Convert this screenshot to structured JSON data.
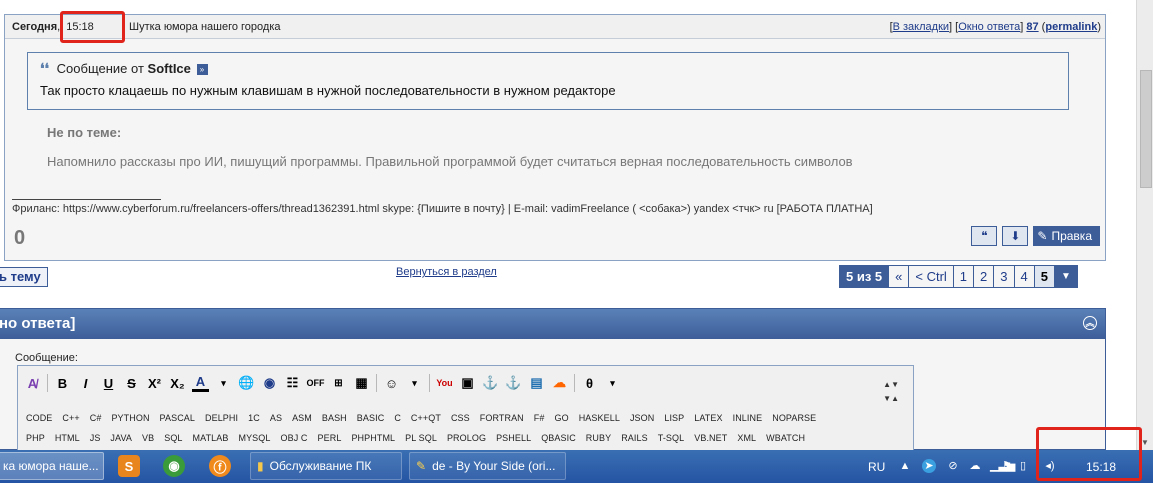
{
  "post": {
    "day": "Сегодня",
    "time": "15:18",
    "title": "Шутка юмора нашего городка",
    "links": {
      "bookmarks": "В закладки",
      "reply_window": "Окно ответа",
      "number": "87",
      "permalink": "permalink"
    },
    "quote": {
      "prefix": "Сообщение от",
      "author": "SoftIce",
      "text": "Так просто клацаешь по нужным клавишам в нужной последовательности в нужном редакторе"
    },
    "offtopic_head": "Не по теме:",
    "offtopic_text": "Напомнило рассказы про ИИ, пишущий программы. Правильной программой будет считаться верная последовательность символов",
    "signature": "Фриланс: https://www.cyberforum.ru/freelancers-offers/thread1362391.html skype: {Пишите в почту} | E-mail: vadimFreelance ( <собака>) yandex <тчк> ru [РАБОТА ПЛАТНА]",
    "rating": "0",
    "edit_label": "Правка"
  },
  "nav": {
    "reply_topic": "ь тему",
    "back_link": "Вернуться в раздел",
    "pager": {
      "summary": "5 из 5",
      "first": "«",
      "prev": "< Ctrl",
      "pages": [
        "1",
        "2",
        "3",
        "4",
        "5"
      ],
      "current": "5"
    }
  },
  "reply": {
    "bar_title": "но ответа]",
    "message_label": "Сообщение:",
    "toolbar_off": "OFF",
    "langs_row1": [
      "CODE",
      "C++",
      "C#",
      "PYTHON",
      "PASCAL",
      "DELPHI",
      "1C",
      "AS",
      "ASM",
      "BASH",
      "BASIC",
      "C",
      "C++QT",
      "CSS",
      "FORTRAN",
      "F#",
      "GO",
      "HASKELL",
      "JSON",
      "LISP",
      "LATEX",
      "INLINE",
      "NOPARSE"
    ],
    "langs_row2": [
      "PHP",
      "HTML",
      "JS",
      "JAVA",
      "VB",
      "SQL",
      "MATLAB",
      "MYSQL",
      "OBJ C",
      "PERL",
      "PHPHTML",
      "PL SQL",
      "PROLOG",
      "PSHELL",
      "QBASIC",
      "RUBY",
      "RAILS",
      "T-SQL",
      "VB.NET",
      "XML",
      "WBATCH"
    ]
  },
  "taskbar": {
    "tasks": [
      "ка юмора наше...",
      "Обслуживание ПК",
      "de - By Your Side (ori..."
    ],
    "lang": "RU",
    "clock": "15:18"
  },
  "colors": {
    "accent": "#3d5d99",
    "highlight": "#e0231b",
    "taskbar": "#2454a3"
  }
}
